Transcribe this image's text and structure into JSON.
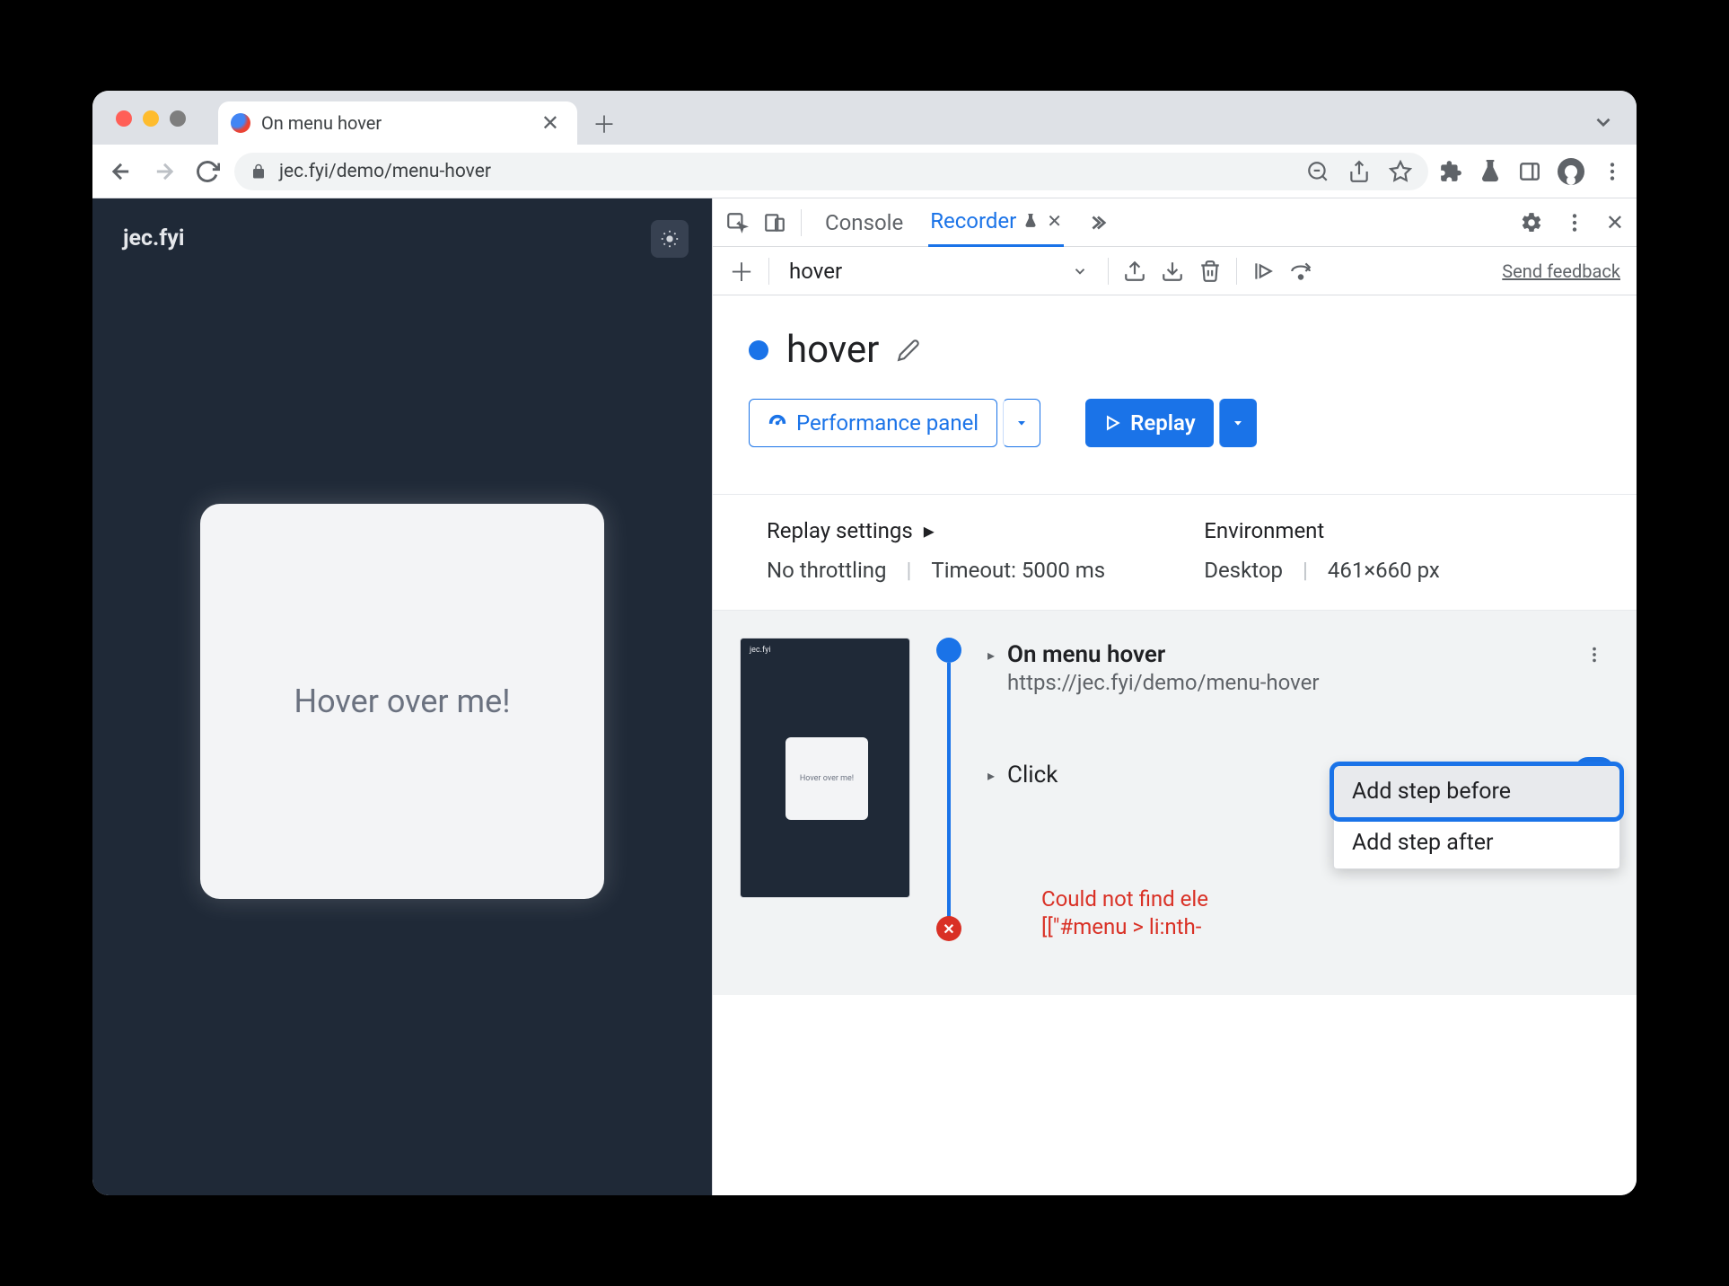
{
  "browser": {
    "tab_title": "On menu hover",
    "url": "jec.fyi/demo/menu-hover"
  },
  "page": {
    "brand": "jec.fyi",
    "card_text": "Hover over me!"
  },
  "devtools": {
    "tabs": {
      "console": "Console",
      "recorder": "Recorder"
    },
    "recorder": {
      "dropdown_value": "hover",
      "feedback": "Send feedback",
      "title": "hover",
      "perf_btn": "Performance panel",
      "replay_btn": "Replay",
      "settings": {
        "replay_heading": "Replay settings",
        "throttling": "No throttling",
        "timeout": "Timeout: 5000 ms",
        "env_heading": "Environment",
        "device": "Desktop",
        "viewport": "461×660 px"
      },
      "steps": [
        {
          "title": "On menu hover",
          "subtitle": "https://jec.fyi/demo/menu-hover"
        },
        {
          "title": "Click"
        }
      ],
      "error_line1": "Could not find ele",
      "error_line2": "[[\"#menu > li:nth-",
      "thumb_card": "Hover over me!",
      "ctx": {
        "before": "Add step before",
        "after": "Add step after"
      }
    }
  }
}
